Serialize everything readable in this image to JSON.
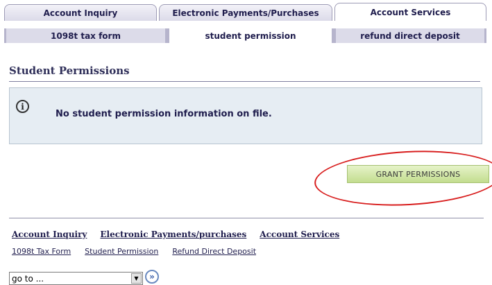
{
  "tabs": [
    {
      "label": "Account Inquiry",
      "active": false
    },
    {
      "label": "Electronic Payments/Purchases",
      "active": false
    },
    {
      "label": "Account Services",
      "active": true
    }
  ],
  "subtabs": [
    {
      "label": "1098t tax form",
      "active": false
    },
    {
      "label": "student permission",
      "active": true
    },
    {
      "label": "refund direct deposit",
      "active": false
    }
  ],
  "page": {
    "title": "Student Permissions"
  },
  "info": {
    "icon": "info-icon",
    "message": "No student permission information on file."
  },
  "actions": {
    "grant_label": "Grant Permissions"
  },
  "footer": {
    "nav": [
      "Account Inquiry",
      "Electronic Payments/purchases",
      "Account Services"
    ],
    "subnav": [
      "1098t Tax Form",
      "Student Permission",
      "Refund Direct Deposit"
    ],
    "goto_value": "go to ...",
    "go_symbol": "»"
  },
  "colors": {
    "accent": "#1f1d4d",
    "tab_bg": "#dcdbe9",
    "button": "#c3dd8f",
    "annotation": "#d81e1e"
  }
}
